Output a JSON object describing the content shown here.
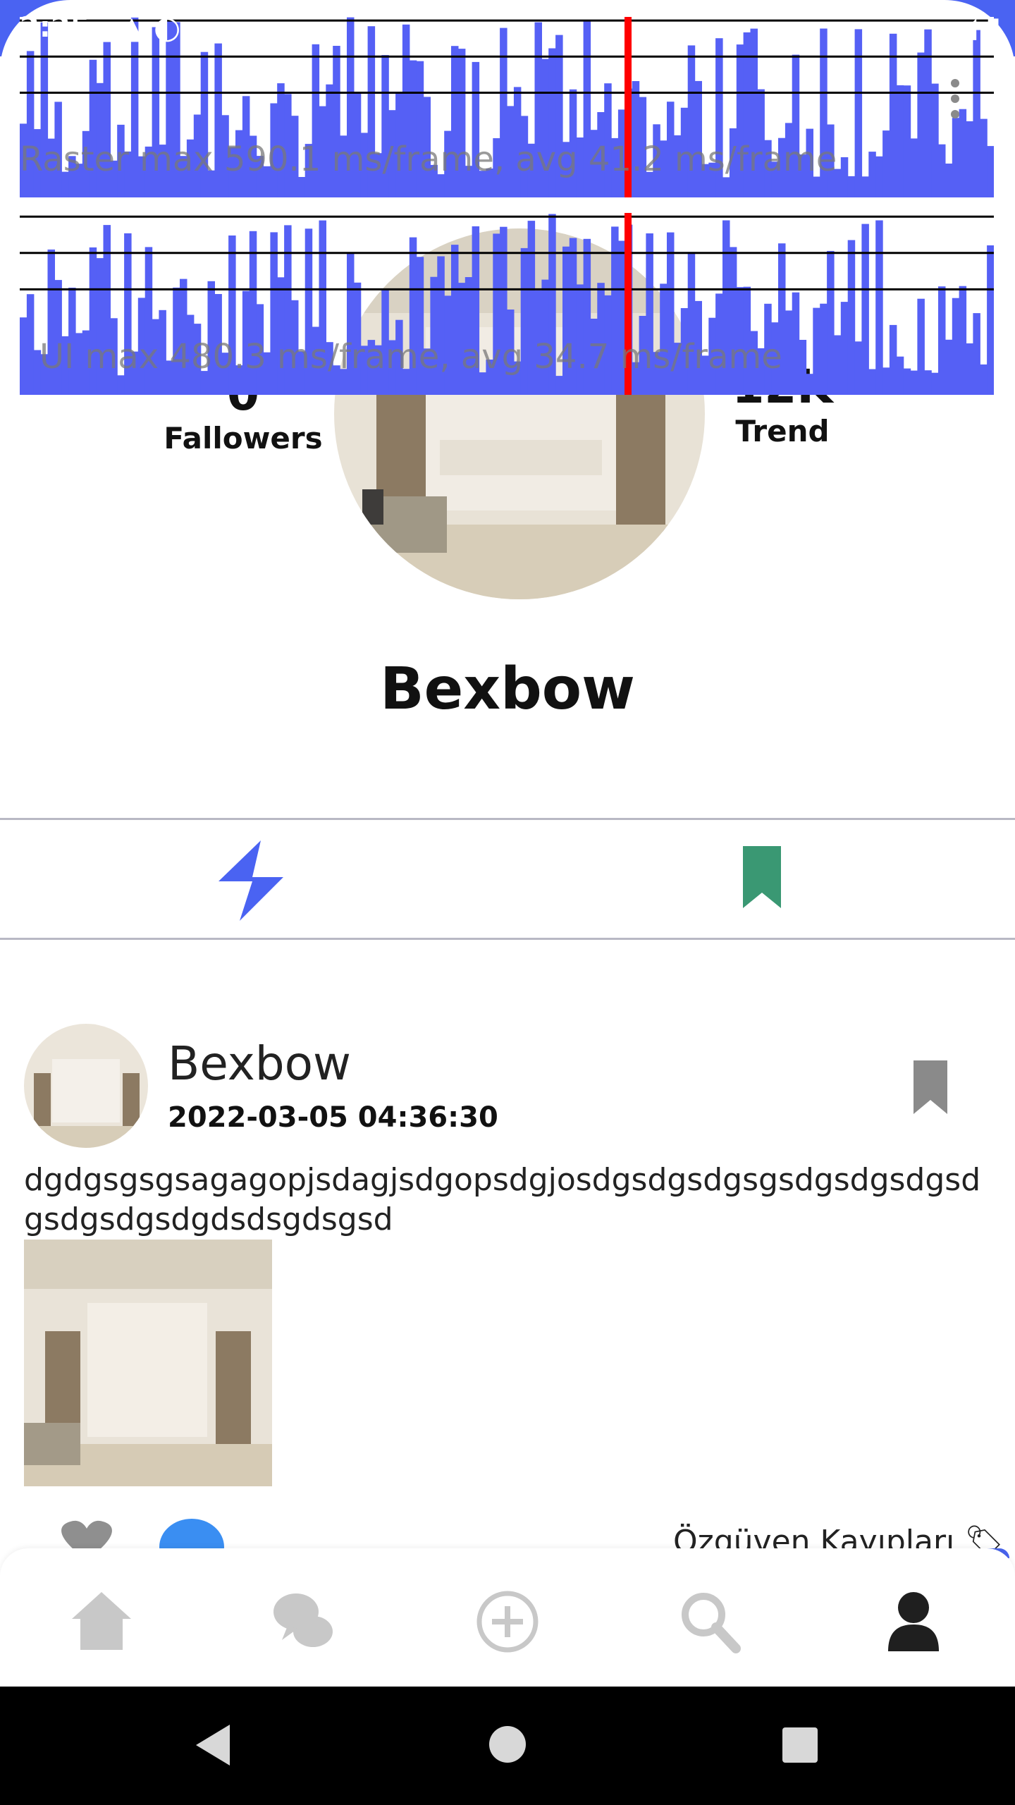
{
  "status_bar": {
    "time": "2:25",
    "left_icons": "▲ ◐",
    "right_icons": "◢ ▮"
  },
  "perf_overlay": {
    "raster_label": "Raster  max 590.1 ms/frame, avg 41.2 ms/frame",
    "ui_label": "UI  max 480.3 ms/frame, avg 34.7 ms/frame",
    "bar_color": "#5560f5",
    "marker_color": "#ff0000"
  },
  "profile": {
    "name": "Bexbow",
    "followers_count": "0",
    "followers_label": "Fallowers",
    "trend_count": "12K",
    "trend_label": "Trend"
  },
  "tabs": [
    {
      "icon": "lightning-icon",
      "color": "#4a63f2"
    },
    {
      "icon": "bookmark-icon",
      "color": "#3a9873"
    }
  ],
  "post": {
    "author": "Bexbow",
    "date": "2022-03-05 04:36:30",
    "text": "dgdgsgsgsagagopjsdagjsdgopsdgjosdgsdgsdgsgsdgsdgsdgsdgsdgsdgsdgdsdsgdsgsd",
    "tag": "Özgüven Kayıpları"
  },
  "bottom_nav": [
    {
      "icon": "home-icon"
    },
    {
      "icon": "chat-icon"
    },
    {
      "icon": "add-icon"
    },
    {
      "icon": "search-icon"
    },
    {
      "icon": "profile-icon"
    }
  ]
}
